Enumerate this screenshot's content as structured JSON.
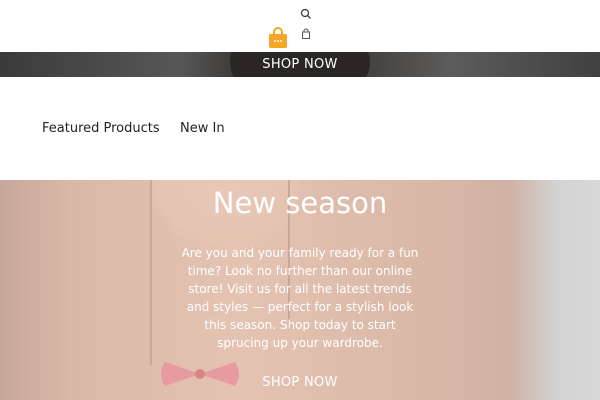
{
  "header": {
    "logo_icon": "shopping-bag-logo-icon",
    "search_icon": "search-icon",
    "cart_icon": "cart-icon",
    "accent_color": "#f5a623"
  },
  "hero_top": {
    "cta_label": "SHOP NOW"
  },
  "tabs": [
    {
      "label": "Featured Products"
    },
    {
      "label": "New In"
    }
  ],
  "season_banner": {
    "title": "New season",
    "text": "Are you and your family ready for a fun time? Look no further than our online store! Visit us for all the latest trends and styles — perfect for a stylish look this season. Shop today to start sprucing up your wardrobe.",
    "cta_label": "SHOP NOW"
  }
}
